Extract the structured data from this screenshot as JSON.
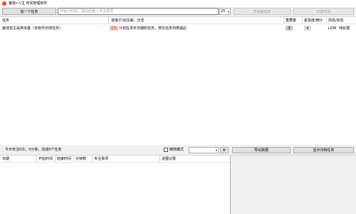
{
  "window": {
    "title": "番茄•人生 时间管理软件"
  },
  "toolbar": {
    "add_task_label": "加一个任务",
    "search_placeholder": "开始计时前，请在此输入专注事项",
    "duration_value": "25",
    "start_label": "开始番茄钟",
    "record_label": "记录时间"
  },
  "task_table": {
    "headers": [
      "任务",
      "进度/行动注解、日志",
      "重要度",
      "紧急度/倒计",
      "风险/状态"
    ],
    "rows": [
      {
        "task": "最佳自主采用本盘（本软件示例任务）",
        "progress_badge": "1%",
        "note": "计划在本年日期的任务，排在任务列表最后",
        "importance_text": "3",
        "urgency_text": "4",
        "risk": "LOW",
        "status": "待处理"
      }
    ]
  },
  "status_bar": {
    "summary_text": "今日专注0次，0分钟，完成0个任务",
    "concise_mode_label": "精简模式",
    "gear_symbol": "⚙",
    "export_label": "导出数据",
    "show_archived_label": "显示归档任务"
  },
  "log_table": {
    "headers": [
      "日期",
      "开始时间",
      "结束时间",
      "分钟数",
      "专注事项",
      "进展记录"
    ]
  },
  "colors": {
    "title_icon": "#e8501a",
    "progress_badge_bg": "#f6c3c3",
    "progress_badge_fg": "#c0392b"
  }
}
